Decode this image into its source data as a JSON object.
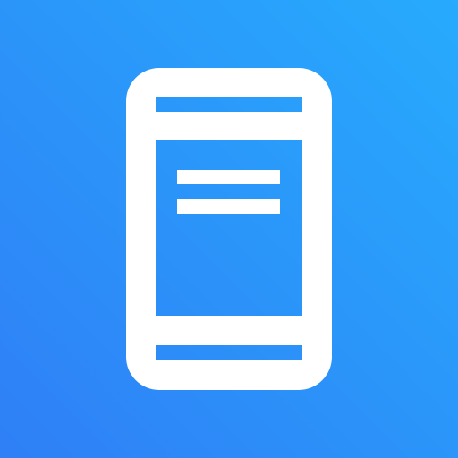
{
  "icon": {
    "name": "phone-document-icon",
    "colors": {
      "background_start": "#2f7ff6",
      "background_end": "#27abfd",
      "foreground": "#ffffff"
    }
  }
}
